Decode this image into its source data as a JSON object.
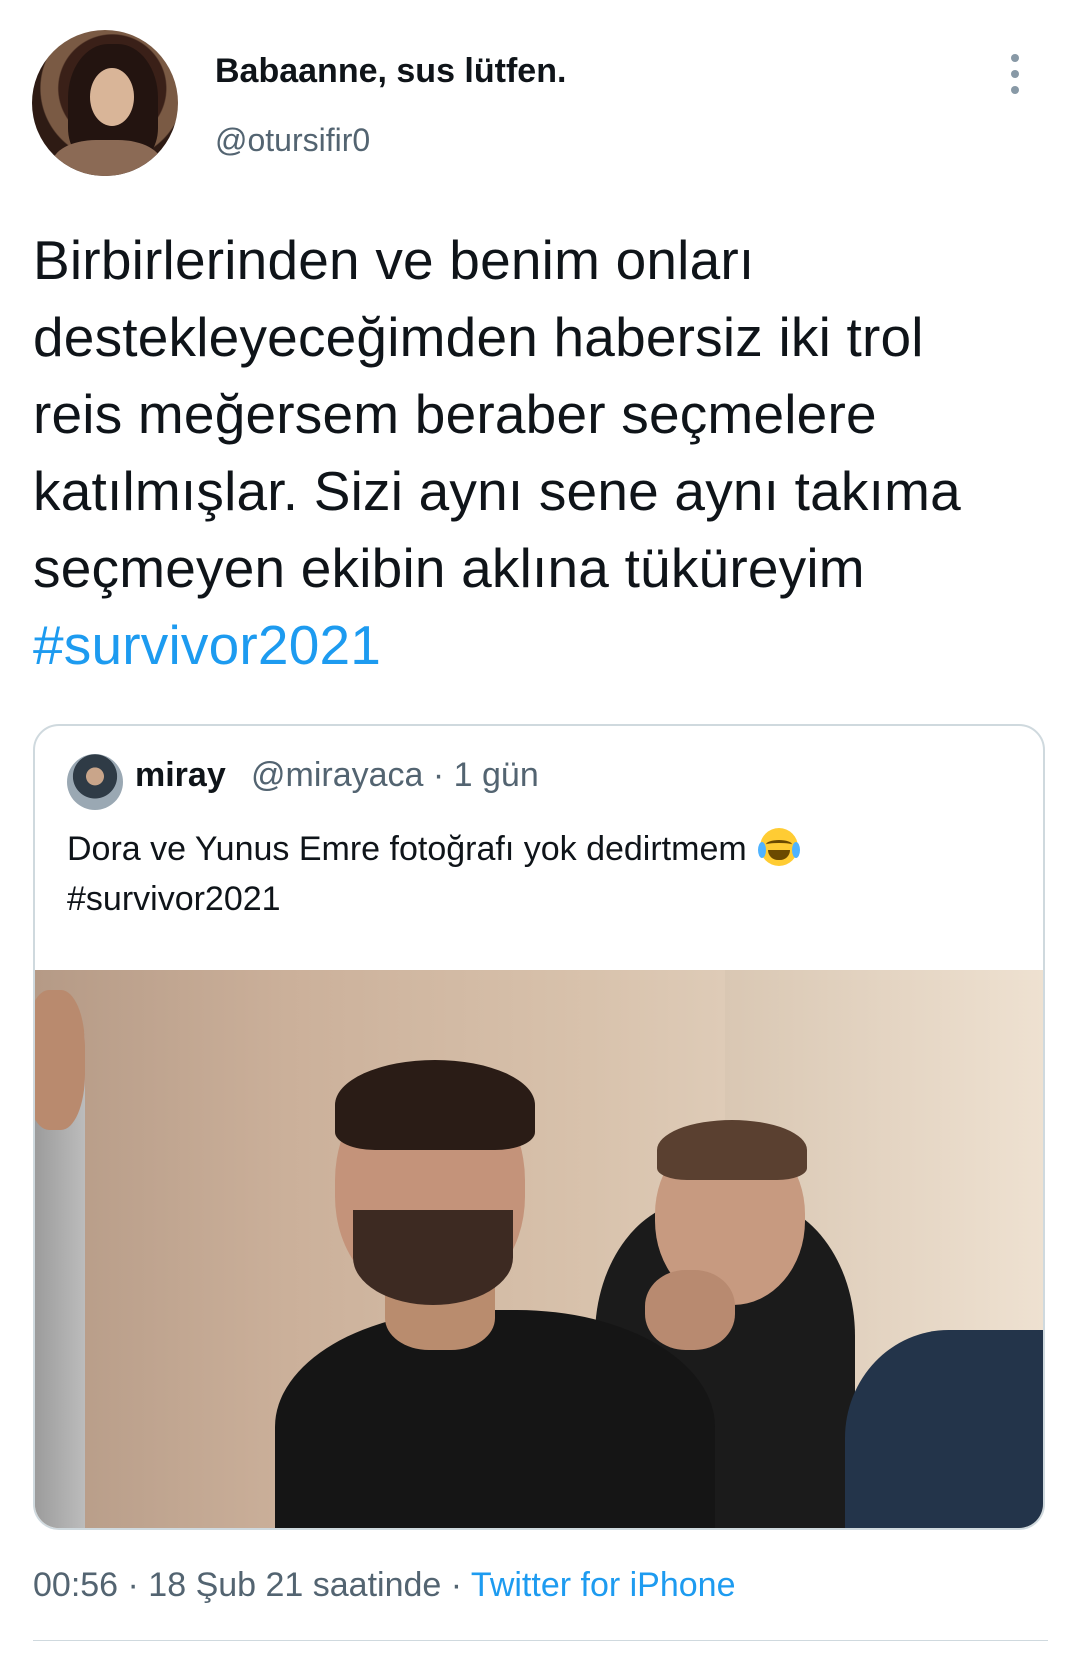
{
  "tweet": {
    "display_name": "Babaanne, sus lütfen.",
    "handle": "@otursifir0",
    "text_lines": [
      "Birbirlerinden ve benim onları",
      "destekleyeceğimden habersiz iki trol",
      "reis meğersem beraber seçmelere",
      "katılmışlar. Sizi aynı sene aynı takıma",
      "seçmeyen ekibin aklına tüküreyim"
    ],
    "hashtag": "#survivor2021"
  },
  "quote": {
    "display_name": "miray",
    "meta": "@mirayaca · 1 gün",
    "text": "Dora ve Yunus Emre fotoğrafı yok dedirtmem",
    "emoji_icon": "face-with-tears-of-joy-icon",
    "hashtag": "#survivor2021"
  },
  "footer": {
    "timestamp": "00:56 · 18 Şub 21 saatinde · ",
    "source": "Twitter for iPhone"
  },
  "colors": {
    "link": "#1d9bf0",
    "secondary_text": "#536471",
    "border": "#cfd9de"
  },
  "icons": {
    "more": "more-vertical-icon"
  }
}
